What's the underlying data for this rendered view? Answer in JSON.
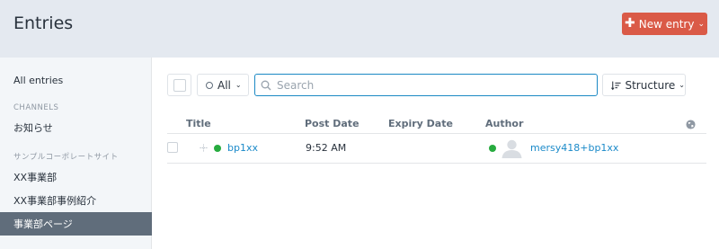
{
  "header": {
    "title": "Entries",
    "new_entry_label": "New entry",
    "new_entry_icon": "plus-icon",
    "accent_color": "#da5a47"
  },
  "sidebar": {
    "all_entries": "All entries",
    "channels_heading": "CHANNELS",
    "channels": [
      "お知らせ"
    ],
    "site_heading": "サンプルコーポレートサイト",
    "site_items": [
      "XX事業部",
      "XX事業部事例紹介",
      "事業部ページ"
    ],
    "selected": "事業部ページ"
  },
  "toolbar": {
    "status_filter": "All",
    "search_placeholder": "Search",
    "search_value": "",
    "structure_label": "Structure"
  },
  "table": {
    "columns": [
      "Title",
      "Post Date",
      "Expiry Date",
      "Author"
    ],
    "rows": [
      {
        "title": "bp1xx",
        "status": "live",
        "status_color": "#27ab3f",
        "post_date": "9:52 AM",
        "expiry_date": "",
        "author": "mersy418+bp1xx",
        "author_status_color": "#27ab3f"
      }
    ]
  }
}
